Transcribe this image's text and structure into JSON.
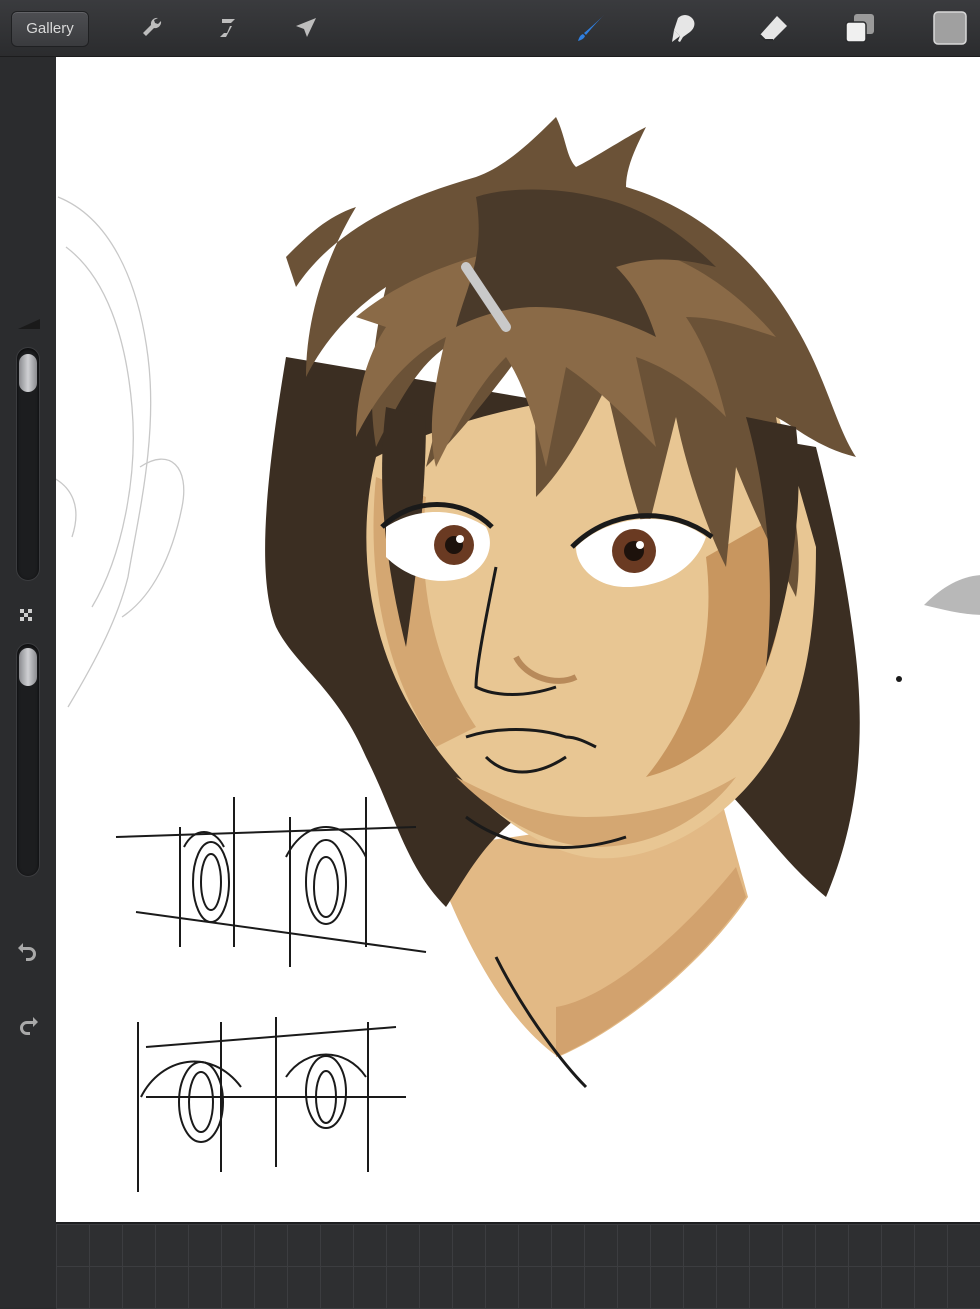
{
  "toolbar": {
    "gallery_label": "Gallery",
    "icons": [
      "wrench-icon",
      "adjustments-icon",
      "selection-arrow-icon",
      "brush-icon",
      "smudge-icon",
      "eraser-icon",
      "layers-icon",
      "color-swatch-icon"
    ],
    "active_tool": "brush",
    "accent_color": "#2f7fe0",
    "swatch_color": "#a0a0a0"
  },
  "sidebar": {
    "icons": [
      "brush-size-icon",
      "opacity-icon",
      "undo-icon",
      "redo-icon"
    ]
  },
  "palette": {
    "hair_dark": "#3b2e22",
    "hair_mid": "#6b5237",
    "hair_light": "#8a6a47",
    "skin_light": "#e8c693",
    "skin_mid": "#d4a772",
    "skin_shadow": "#b88a5a",
    "iris": "#6a3a22"
  }
}
